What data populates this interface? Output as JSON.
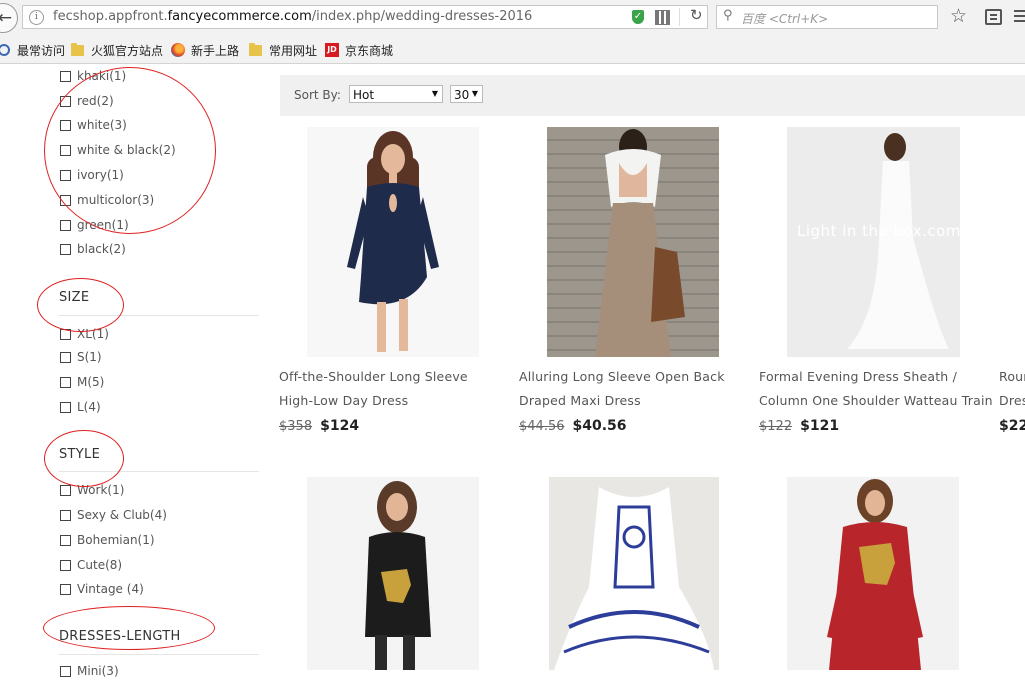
{
  "browser": {
    "url_prefix": "fecshop.appfront.",
    "url_domain": "fancyecommerce.com",
    "url_path": "/index.php/wedding-dresses-2016",
    "search_placeholder": "百度 <Ctrl+K>"
  },
  "bookmarks": [
    {
      "label": "最常访问",
      "icon": "gear-icon"
    },
    {
      "label": "火狐官方站点",
      "icon": "folder-icon"
    },
    {
      "label": "新手上路",
      "icon": "firefox-icon"
    },
    {
      "label": "常用网址",
      "icon": "folder-icon"
    },
    {
      "label": "京东商城",
      "icon": "jd-icon",
      "icon_text": "JD"
    }
  ],
  "filters": {
    "colors": [
      "khaki(1)",
      "red(2)",
      "white(3)",
      "white & black(2)",
      "ivory(1)",
      "multicolor(3)",
      "green(1)",
      "black(2)"
    ],
    "size_heading": "SIZE",
    "sizes": [
      "XL(1)",
      "S(1)",
      "M(5)",
      "L(4)"
    ],
    "style_heading": "STYLE",
    "styles": [
      "Work(1)",
      "Sexy & Club(4)",
      "Bohemian(1)",
      "Cute(8)",
      "Vintage (4)"
    ],
    "length_heading": "DRESSES-LENGTH",
    "lengths": [
      "Mini(3)"
    ]
  },
  "sort": {
    "label": "Sort By:",
    "value": "Hot",
    "per_page": "30"
  },
  "products": [
    {
      "line1": "Off-the-Shoulder Long Sleeve",
      "line2": "High-Low Day Dress",
      "old_price": "$358",
      "price": "$124",
      "color": "#1f2b4a"
    },
    {
      "line1": "Alluring Long Sleeve Open Back",
      "line2": "Draped Maxi Dress",
      "old_price": "$44.56",
      "price": "$40.56",
      "color": "#a58f7b"
    },
    {
      "line1": "Formal Evening Dress Sheath /",
      "line2": "Column One Shoulder Watteau Train",
      "old_price": "$122",
      "price": "$121",
      "color": "#f4f4f4",
      "watermark": "Light in the box.com"
    },
    {
      "line1": "Rour",
      "line2": "Dres",
      "old_price": "",
      "price": "$22"
    }
  ],
  "products_row2": [
    {
      "color": "#1c1c1c",
      "accent": "#c9a13c"
    },
    {
      "color": "#ffffff",
      "accent": "#2d3d9a"
    },
    {
      "color": "#b8252b",
      "accent": "#c9a13c"
    }
  ]
}
